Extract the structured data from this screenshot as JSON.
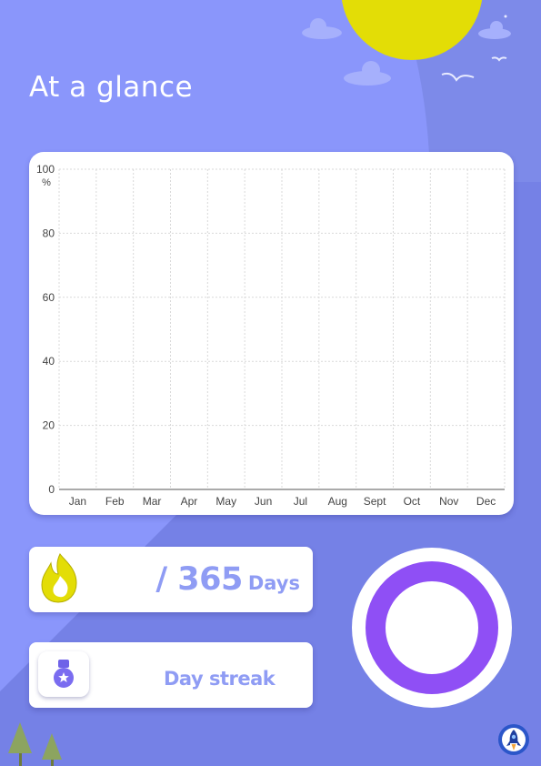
{
  "page": {
    "title": "At a glance"
  },
  "chart_data": {
    "type": "line",
    "categories": [
      "Jan",
      "Feb",
      "Mar",
      "Apr",
      "May",
      "Jun",
      "Jul",
      "Aug",
      "Sept",
      "Oct",
      "Nov",
      "Dec"
    ],
    "series": [],
    "ylabel": "%",
    "ylim": [
      0,
      100
    ],
    "yticks": [
      "0",
      "20",
      "40",
      "60",
      "80",
      "100"
    ],
    "grid": true
  },
  "stats": {
    "days_total": "/ 365",
    "days_unit": "Days",
    "streak_label": "Day streak"
  },
  "icons": {
    "fire": "fire-icon",
    "medal": "medal-icon",
    "rocket": "rocket-icon"
  },
  "colors": {
    "background": "#8a96fb",
    "sun": "#e3dd06",
    "accent": "#8f9cf4",
    "ring": "#8f4ff5"
  }
}
